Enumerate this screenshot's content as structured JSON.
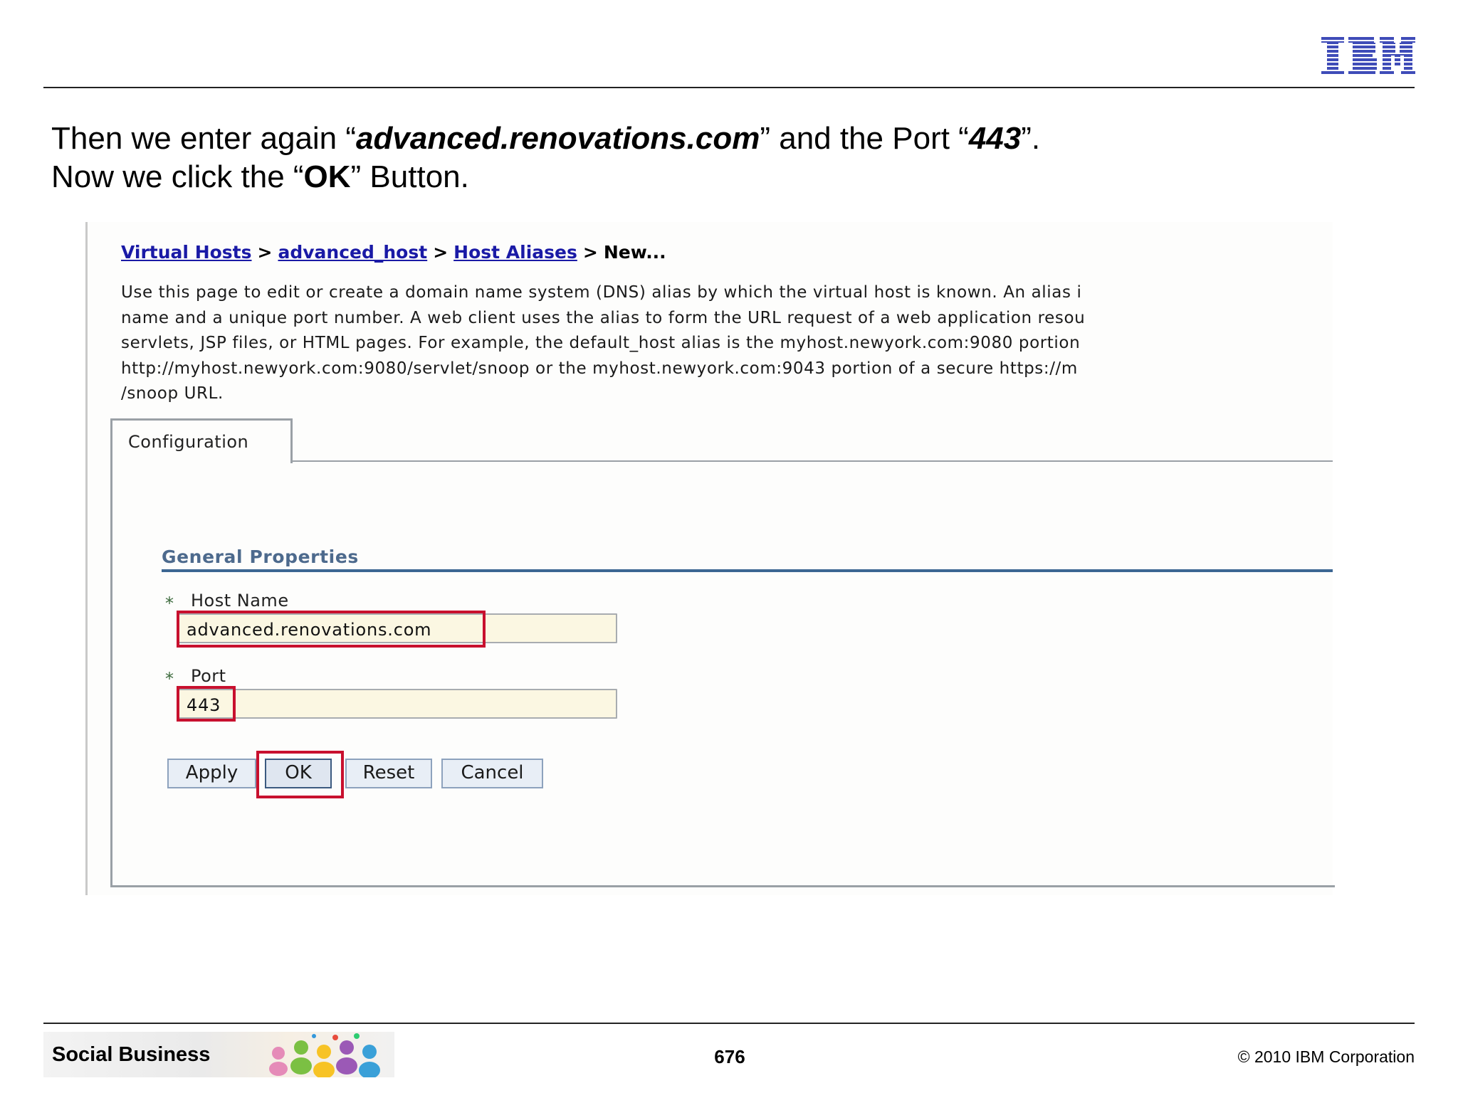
{
  "header": {
    "logo_text": "IBM"
  },
  "instructions": {
    "line1_before": "Then we enter again “",
    "line1_host": "advanced.renovations.com",
    "line1_mid": "” and the Port “",
    "line1_port": "443",
    "line1_after": "”.",
    "line2_before": "Now we click the “",
    "line2_ok": "OK",
    "line2_after": "” Button."
  },
  "console": {
    "breadcrumb": {
      "items": [
        "Virtual Hosts",
        "advanced_host",
        "Host Aliases"
      ],
      "current": "New...",
      "separator": ">"
    },
    "description_lines": [
      "Use this page to edit or create a domain name system (DNS) alias by which the virtual host is known. An alias i",
      "name and a unique port number. A web client uses the alias to form the URL request of a web application resou",
      "servlets, JSP files, or HTML pages. For example, the default_host alias is the myhost.newyork.com:9080 portion",
      "http://myhost.newyork.com:9080/servlet/snoop or the myhost.newyork.com:9043 portion of a secure https://m",
      "/snoop URL."
    ],
    "tabs": [
      "Configuration"
    ],
    "section_title": "General Properties",
    "fields": {
      "host_name": {
        "label": "Host Name",
        "value": "advanced.renovations.com",
        "required": true
      },
      "port": {
        "label": "Port",
        "value": "443",
        "required": true
      }
    },
    "buttons": {
      "apply": "Apply",
      "ok": "OK",
      "reset": "Reset",
      "cancel": "Cancel"
    },
    "required_marker": "*"
  },
  "footer": {
    "banner_label": "Social Business",
    "page_number": "676",
    "copyright": "© 2010 IBM Corporation"
  },
  "colors": {
    "ibm_blue": "#3f4cb8",
    "link_blue": "#1a1aa6",
    "section_blue": "#3c6692",
    "highlight_red": "#c8102e",
    "input_bg": "#fbf7e2"
  }
}
